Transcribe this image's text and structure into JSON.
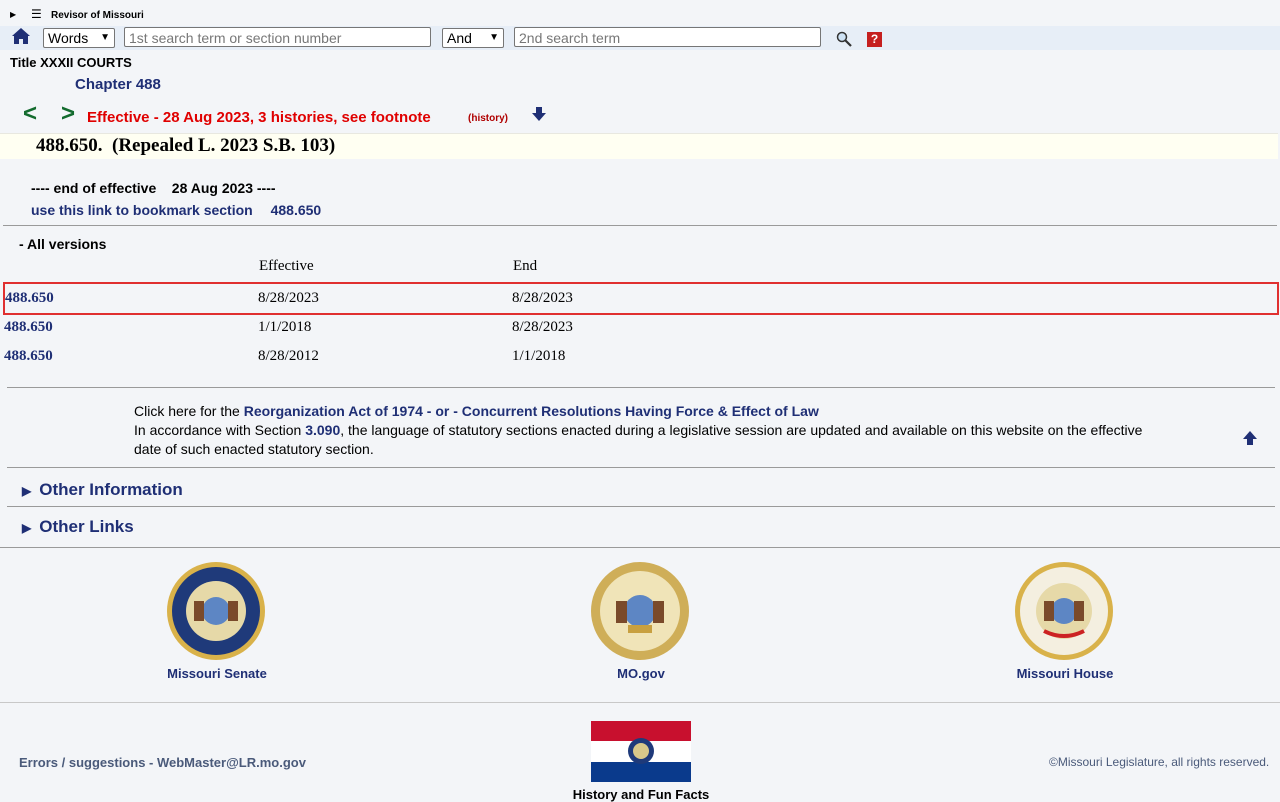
{
  "site": {
    "title": "Revisor of Missouri"
  },
  "search": {
    "mode_selected": "Words",
    "term1_placeholder": "1st search term or section number",
    "operator_selected": "And",
    "term2_placeholder": "2nd search term",
    "help_label": "?"
  },
  "breadcrumb": {
    "title": "Title XXXII COURTS",
    "chapter": "Chapter 488"
  },
  "nav": {
    "prev": "<",
    "next": ">",
    "effective": "Effective - 28 Aug 2023, 3 histories, see footnote",
    "history": "(history)"
  },
  "section": {
    "heading": "488.650.  (Repealed L. 2023 S.B. 103)",
    "end_of_effective": "---- end of effective    28 Aug 2023 ----",
    "bookmark_text": "use this link to bookmark section",
    "bookmark_section": "488.650"
  },
  "versions": {
    "label": "- All versions",
    "col_effective": "Effective",
    "col_end": "End",
    "rows": [
      {
        "section": "488.650",
        "effective": "8/28/2023",
        "end": "8/28/2023",
        "selected": true
      },
      {
        "section": "488.650",
        "effective": "1/1/2018",
        "end": "8/28/2023",
        "selected": false
      },
      {
        "section": "488.650",
        "effective": "8/28/2012",
        "end": "1/1/2018",
        "selected": false
      }
    ]
  },
  "notes": {
    "click_prefix": "Click here for the",
    "reorg_link": "Reorganization Act of 1974",
    "or": " - or - ",
    "concurrent_link": "Concurrent Resolutions Having Force & Effect of Law",
    "accord_prefix": "In accordance with Section",
    "accord_section": "3.090",
    "accord_suffix": ", the language of statutory sections enacted during a legislative session are updated and available on this website on the effective date of such enacted statutory section."
  },
  "sections_collapsed": {
    "other_information": "Other Information",
    "other_links": "Other Links"
  },
  "seals": {
    "senate": "Missouri Senate",
    "mogov": "MO.gov",
    "house": "Missouri House"
  },
  "footer": {
    "errors": "Errors / suggestions - WebMaster@LR.mo.gov",
    "copyright": "©Missouri Legislature, all rights reserved.",
    "fun_facts": "History and Fun Facts"
  },
  "colors": {
    "link_navy": "#1f2f75",
    "effective_red": "#e00000",
    "nav_green": "#136b2e",
    "selected_row_border": "#e03030"
  }
}
